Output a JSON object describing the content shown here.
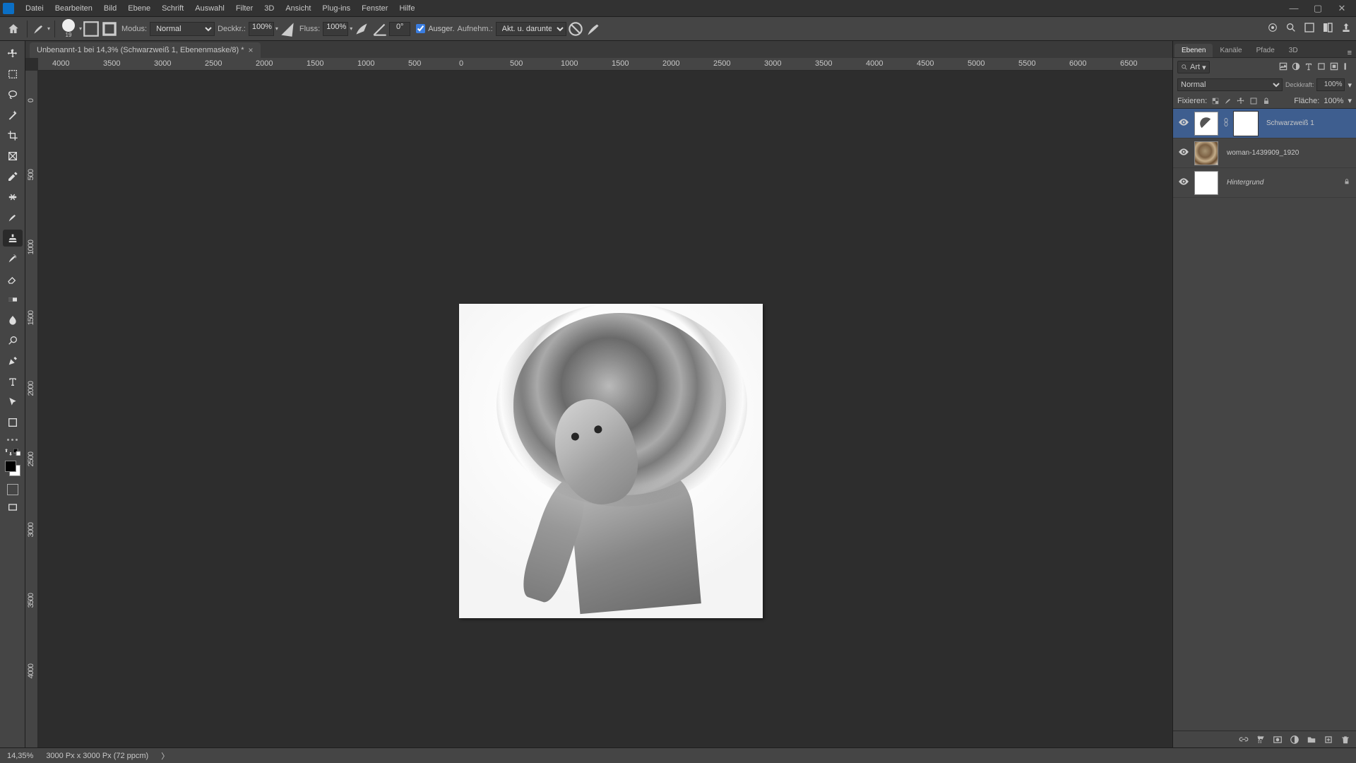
{
  "menu": [
    "Datei",
    "Bearbeiten",
    "Bild",
    "Ebene",
    "Schrift",
    "Auswahl",
    "Filter",
    "3D",
    "Ansicht",
    "Plug-ins",
    "Fenster",
    "Hilfe"
  ],
  "options": {
    "brush_size": "19",
    "mode_label": "Modus:",
    "mode_value": "Normal",
    "opacity_label": "Deckkr.:",
    "opacity_value": "100%",
    "flow_label": "Fluss:",
    "flow_value": "100%",
    "angle_value": "0°",
    "sample_checkbox": "Ausger.",
    "sample_label2": "Aufnehm.:",
    "sample_mode": "Akt. u. darunter"
  },
  "doc": {
    "tab_title": "Unbenannt-1 bei 14,3% (Schwarzweiß 1, Ebenenmaske/8) *"
  },
  "ruler_h": [
    "4000",
    "3500",
    "3000",
    "2500",
    "2000",
    "1500",
    "1000",
    "500",
    "0",
    "500",
    "1000",
    "1500",
    "2000",
    "2500",
    "3000",
    "3500",
    "4000",
    "4500",
    "5000",
    "5500",
    "6000",
    "6500"
  ],
  "ruler_v": [
    "0",
    "500",
    "1000",
    "1500",
    "2000",
    "2500",
    "3000",
    "3500",
    "4000"
  ],
  "panels": {
    "tabs": [
      "Ebenen",
      "Kanäle",
      "Pfade",
      "3D"
    ],
    "filter_label": "Art",
    "blend_mode": "Normal",
    "opacity_label": "Deckkraft:",
    "opacity_value": "100%",
    "lock_label": "Fixieren:",
    "fill_label": "Fläche:",
    "fill_value": "100%",
    "layers": [
      {
        "name": "Schwarzweiß 1",
        "selected": true,
        "type": "adjust"
      },
      {
        "name": "woman-1439909_1920",
        "selected": false,
        "type": "image"
      },
      {
        "name": "Hintergrund",
        "selected": false,
        "type": "bg",
        "locked": true
      }
    ]
  },
  "status": {
    "zoom": "14,35%",
    "dims": "3000 Px x 3000 Px (72 ppcm)"
  }
}
